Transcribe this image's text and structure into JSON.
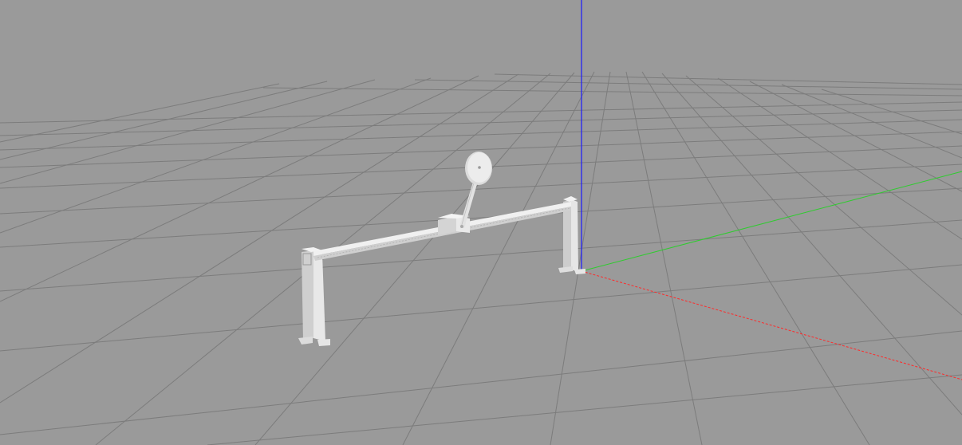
{
  "scene": {
    "background_color": "#9a9a9a",
    "grid_color": "#7a7a7a",
    "axes": {
      "x_color": "#ff2a2a",
      "y_color": "#2ecc2e",
      "z_color": "#1a1aff"
    },
    "model": {
      "name_icon": "cart-pole-model",
      "color": "#e6e6e6",
      "shade_color": "#c8c8c8",
      "dark_color": "#b4b4b4"
    }
  }
}
